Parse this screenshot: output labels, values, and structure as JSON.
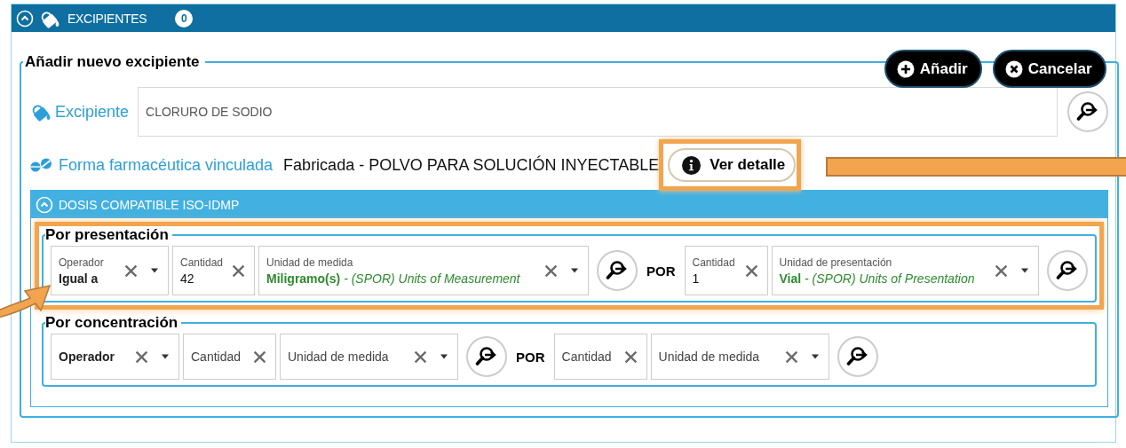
{
  "panel": {
    "title": "EXCIPIENTES",
    "count": "0",
    "expanded": true
  },
  "form": {
    "legend": "Añadir nuevo excipiente",
    "buttons": [
      {
        "kind": "add",
        "label": "Añadir"
      },
      {
        "kind": "cancel",
        "label": "Cancelar"
      }
    ],
    "excipient": {
      "label": "Excipiente",
      "value": "CLORURO DE SODIO"
    },
    "dosage_form": {
      "label": "Forma farmacéutica vinculada",
      "value": "Fabricada - POLVO PARA SOLUCIÓN INYECTABLE",
      "detail_button": "Ver detalle"
    }
  },
  "dose_section": {
    "title": "DOSIS COMPATIBLE ISO-IDMP",
    "expanded": true,
    "groups": [
      {
        "legend": "Por presentación",
        "highlighted": true,
        "items": [
          {
            "kind": "select",
            "label": "Operador",
            "value": "Igual a",
            "strong": true
          },
          {
            "kind": "input",
            "label": "Cantidad",
            "value": "42"
          },
          {
            "kind": "select",
            "label": "Unidad de medida",
            "value": "**Miligramo(s)** *- (SPOR) Units of Measurement*"
          },
          {
            "kind": "lookup"
          },
          {
            "kind": "separator",
            "text": "POR"
          },
          {
            "kind": "input",
            "label": "Cantidad",
            "value": "1"
          },
          {
            "kind": "select",
            "label": "Unidad de presentación",
            "value": "**Vial** *- (SPOR) Units of Presentation*"
          },
          {
            "kind": "lookup"
          }
        ]
      },
      {
        "legend": "Por concentración",
        "highlighted": false,
        "items": [
          {
            "kind": "select",
            "placeholder": "Operador",
            "strong": true
          },
          {
            "kind": "input",
            "placeholder": "Cantidad"
          },
          {
            "kind": "select",
            "placeholder": "Unidad de medida"
          },
          {
            "kind": "lookup"
          },
          {
            "kind": "separator",
            "text": "POR"
          },
          {
            "kind": "input",
            "placeholder": "Cantidad"
          },
          {
            "kind": "select",
            "placeholder": "Unidad de medida"
          },
          {
            "kind": "lookup"
          }
        ]
      }
    ]
  }
}
